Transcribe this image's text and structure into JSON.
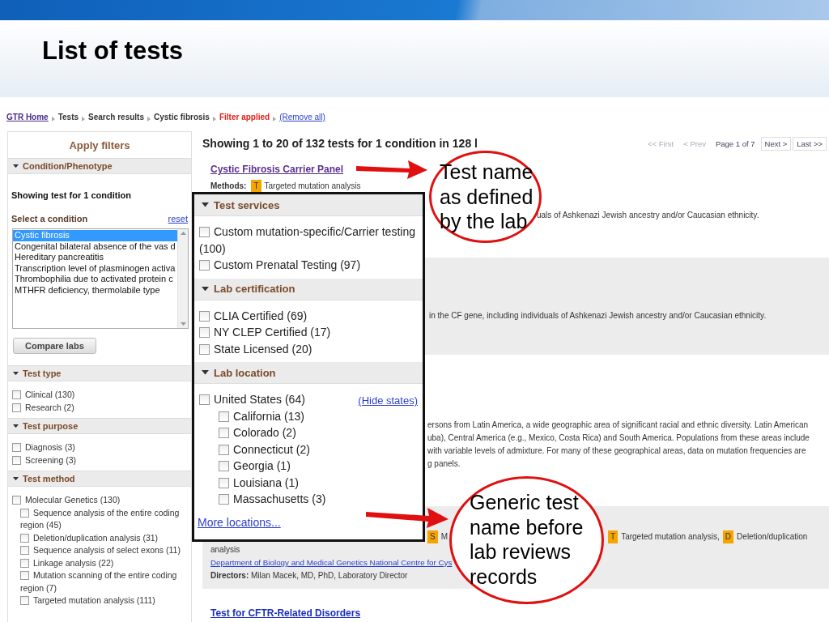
{
  "slide": {
    "title": "List of tests"
  },
  "breadcrumb": [
    {
      "label": "GTR Home",
      "kind": "home"
    },
    {
      "label": "Tests",
      "kind": "crumb"
    },
    {
      "label": "Search results",
      "kind": "crumb"
    },
    {
      "label": "Cystic fibrosis",
      "kind": "crumb"
    },
    {
      "label": "Filter applied",
      "kind": "alert"
    },
    {
      "label": "(Remove all)",
      "kind": "link"
    }
  ],
  "sidebar": {
    "title": "Apply filters",
    "sections": [
      {
        "kind": "condition",
        "heading": "Condition/Phenotype",
        "note": "Showing test for 1 condition",
        "select_label": "Select a condition",
        "reset": "reset",
        "button": "Compare labs",
        "options": [
          {
            "label": "Cystic fibrosis",
            "selected": true
          },
          {
            "label": "Congenital bilateral absence of the vas d",
            "selected": false
          },
          {
            "label": "Hereditary pancreatitis",
            "selected": false
          },
          {
            "label": "Transcription level of plasminogen activa",
            "selected": false
          },
          {
            "label": "Thrombophilia due to activated protein c",
            "selected": false
          },
          {
            "label": "MTHFR deficiency, thermolabile type",
            "selected": false
          }
        ]
      },
      {
        "kind": "checks",
        "heading": "Test type",
        "items": [
          {
            "label": "Clinical (130)",
            "checked": false
          },
          {
            "label": "Research (2)",
            "checked": false
          }
        ]
      },
      {
        "kind": "checks",
        "heading": "Test purpose",
        "items": [
          {
            "label": "Diagnosis (3)",
            "checked": false
          },
          {
            "label": "Screening (3)",
            "checked": false
          }
        ]
      },
      {
        "kind": "checks",
        "heading": "Test method",
        "items": [
          {
            "label": "Molecular Genetics (130)",
            "checked": false,
            "children": [
              {
                "label": "Sequence analysis of the entire coding region (45)",
                "checked": false
              },
              {
                "label": "Deletion/duplication analysis (31)",
                "checked": false
              },
              {
                "label": "Sequence analysis of select exons (11)",
                "checked": false
              },
              {
                "label": "Linkage analysis (22)",
                "checked": false
              },
              {
                "label": "Mutation scanning of the entire coding region (7)",
                "checked": false
              },
              {
                "label": "Targeted mutation analysis (111)",
                "checked": false
              }
            ]
          }
        ]
      }
    ]
  },
  "results": {
    "summary": "Showing 1 to 20 of 132 tests for 1 condition in 128 l",
    "pagination": [
      {
        "label": "<< First",
        "kind": "disabled"
      },
      {
        "label": "< Prev",
        "kind": "disabled"
      },
      {
        "label": "Page 1 of 7",
        "kind": "info"
      },
      {
        "label": "Next >",
        "kind": "button"
      },
      {
        "label": "Last >>",
        "kind": "button"
      }
    ],
    "tests": [
      {
        "shaded": false,
        "title": "Cystic Fibrosis Carrier Panel",
        "visited": true,
        "methods_label": "Methods:",
        "methods": [
          {
            "badge": "T",
            "text": "Targeted mutation analysis"
          }
        ],
        "fragments": [
          "uals of Ashkenazi Jewish ancestry and/or Caucasian ethnicity."
        ]
      },
      {
        "shaded": true,
        "fragments": [
          "in the CF gene, including individuals of Ashkenazi Jewish ancestry and/or Caucasian ethnicity."
        ]
      },
      {
        "shaded": false,
        "fragments": [
          "ersons from Latin America, a wide geographic area of significant racial and ethnic diversity. Latin American",
          "uba), Central America (e.g., Mexico, Costa Rica) and South America. Populations from these areas include",
          "with variable levels of admixture. For many of these geographical areas, data on mutation frequencies are",
          "g panels."
        ]
      },
      {
        "shaded": true,
        "methods": [
          {
            "badge": "S",
            "text": "M"
          },
          {
            "badge": "T",
            "text": "Targeted mutation analysis,"
          },
          {
            "badge": "D",
            "text": "Deletion/duplication"
          }
        ],
        "methods_cont": "analysis",
        "lab": "Department of Biology and Medical Genetics National Centre for Cys",
        "directors": "**Directors:** Milan Macek, MD, PhD, Laboratory Director"
      },
      {
        "shaded": false,
        "title": "Test for CFTR-Related Disorders",
        "visited": false
      }
    ]
  },
  "filter_popup": {
    "sections": [
      {
        "heading": "Test services",
        "items": [
          {
            "label": "Custom mutation-specific/Carrier testing (100)",
            "checked": false
          },
          {
            "label": "Custom Prenatal Testing (97)",
            "checked": false
          }
        ]
      },
      {
        "heading": "Lab certification",
        "items": [
          {
            "label": "CLIA Certified (69)",
            "checked": false
          },
          {
            "label": "NY CLEP Certified (17)",
            "checked": false
          },
          {
            "label": "State Licensed (20)",
            "checked": false
          }
        ]
      },
      {
        "heading": "Lab location",
        "action": "(Hide states)",
        "items": [
          {
            "label": "United States (64)",
            "checked": false,
            "children": [
              {
                "label": "California (13)",
                "checked": false
              },
              {
                "label": "Colorado (2)",
                "checked": false
              },
              {
                "label": "Connecticut (2)",
                "checked": false
              },
              {
                "label": "Georgia (1)",
                "checked": false
              },
              {
                "label": "Louisiana (1)",
                "checked": false
              },
              {
                "label": "Massachusetts (3)",
                "checked": false
              }
            ]
          }
        ]
      }
    ],
    "more_link": "More locations..."
  },
  "callouts": [
    {
      "lines": [
        "Test name",
        "as defined",
        "by the lab"
      ]
    },
    {
      "lines": [
        "Generic test",
        "name before",
        "lab reviews",
        "records"
      ]
    }
  ]
}
